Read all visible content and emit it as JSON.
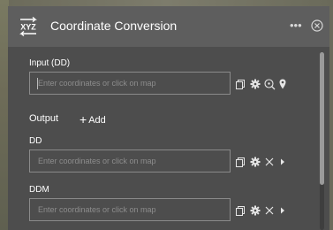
{
  "header": {
    "app_icon_text": "XYZ",
    "title": "Coordinate Conversion",
    "more_icon": "more-icon",
    "close_icon": "close-icon"
  },
  "input": {
    "label": "Input (DD)",
    "placeholder": "Enter coordinates or click on map",
    "icons": [
      "copy-icon",
      "gear-icon",
      "zoom-icon",
      "pin-icon"
    ]
  },
  "output": {
    "label": "Output",
    "add_label": "Add",
    "rows": [
      {
        "label": "DD",
        "placeholder": "Enter coordinates or click on map",
        "icons": [
          "copy-icon",
          "gear-icon",
          "close-icon",
          "expand-icon"
        ]
      },
      {
        "label": "DDM",
        "placeholder": "Enter coordinates or click on map",
        "icons": [
          "copy-icon",
          "gear-icon",
          "close-icon",
          "expand-icon"
        ]
      }
    ]
  },
  "colors": {
    "panel_bg": "#4d4d4d",
    "header_bg": "#5e5e5e",
    "field_border": "#8a8a8a",
    "icon_color": "#e6e6e6"
  }
}
